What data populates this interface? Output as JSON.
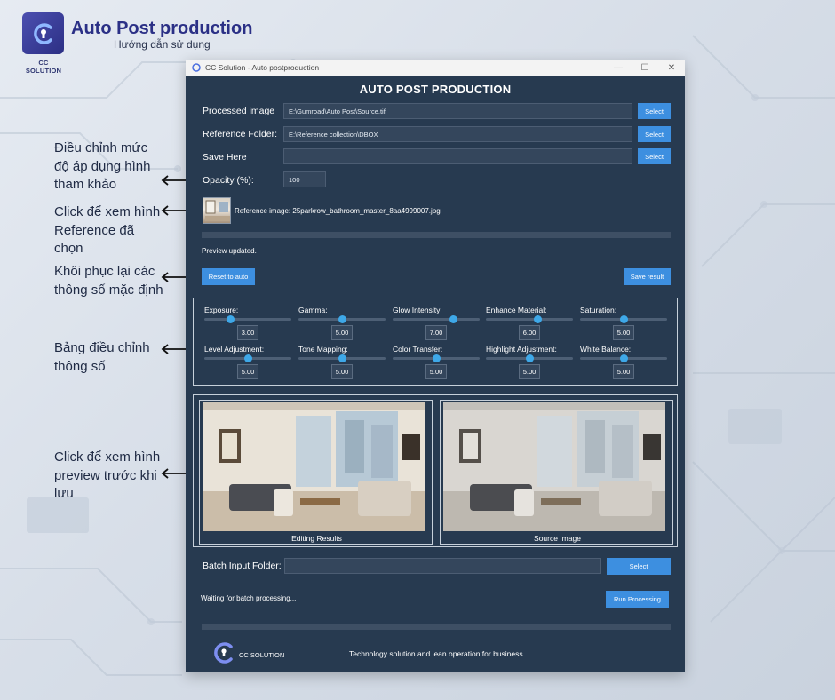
{
  "brand": {
    "title": "Auto Post production",
    "subtitle": "Hướng dẫn sử dụng",
    "tag": "CC SOLUTION",
    "logo_icon": "cc-solution-logo-icon"
  },
  "annotations": [
    {
      "text": "Điều chỉnh mức độ áp dụng hình tham khảo"
    },
    {
      "text": "Click để xem hình Reference đã chọn"
    },
    {
      "text": "Khôi phục lại các thông số mặc định"
    },
    {
      "text": "Bảng điều chỉnh thông số"
    },
    {
      "text": "Click để xem hình preview trước khi lưu"
    }
  ],
  "window": {
    "title": "CC Solution - Auto postproduction",
    "controls": [
      "—",
      "☐",
      "✕"
    ]
  },
  "app": {
    "heading": "AUTO POST PRODUCTION",
    "processed_image": {
      "label": "Processed image",
      "value": "E:\\Gumroad\\Auto Post\\Source.tif",
      "button": "Select"
    },
    "reference_folder": {
      "label": "Reference Folder:",
      "value": "E:\\Reference collection\\DBOX",
      "button": "Select"
    },
    "save_here": {
      "label": "Save Here",
      "value": "",
      "button": "Select"
    },
    "opacity": {
      "label": "Opacity (%):",
      "value": "100"
    },
    "reference_image_text": "Reference image: 25parkrow_bathroom_master_8aa4999007.jpg",
    "preview_status": "Preview updated.",
    "reset_button": "Reset to auto",
    "save_button": "Save result",
    "sliders": [
      {
        "label": "Exposure:",
        "value": "3.00",
        "level": 0.3
      },
      {
        "label": "Gamma:",
        "value": "5.00",
        "level": 0.5
      },
      {
        "label": "Glow Intensity:",
        "value": "7.00",
        "level": 0.7
      },
      {
        "label": "Enhance Material:",
        "value": "6.00",
        "level": 0.6
      },
      {
        "label": "Saturation:",
        "value": "5.00",
        "level": 0.5
      },
      {
        "label": "Level Adjustment:",
        "value": "5.00",
        "level": 0.5
      },
      {
        "label": "Tone Mapping:",
        "value": "5.00",
        "level": 0.5
      },
      {
        "label": "Color Transfer:",
        "value": "5.00",
        "level": 0.5
      },
      {
        "label": "Highlight Adjustment:",
        "value": "5.00",
        "level": 0.5
      },
      {
        "label": "White Balance:",
        "value": "5.00",
        "level": 0.5
      }
    ],
    "previews": {
      "editing": "Editing Results",
      "source": "Source Image"
    },
    "batch": {
      "label": "Batch Input Folder:",
      "value": "",
      "button": "Select",
      "status": "Waiting for batch processing...",
      "run_button": "Run Processing"
    },
    "footer": {
      "logo_text": "CC SOLUTION",
      "tagline": "Technology solution and lean operation for business"
    }
  },
  "colors": {
    "accent": "#3d8fe0",
    "window_bg": "#273a50",
    "brand": "#2b3086",
    "knob": "#3ea8e8"
  }
}
